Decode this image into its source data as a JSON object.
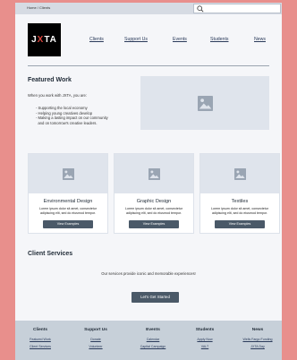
{
  "breadcrumb": "Home / Clients",
  "search": {
    "placeholder": ""
  },
  "logo": {
    "text_j": "J",
    "text_x": "X",
    "text_ta": "TA"
  },
  "nav": [
    "Clients",
    "Support Us",
    "Events",
    "Students",
    "News"
  ],
  "featured": {
    "title": "Featured Work",
    "intro": "When you work with JXTA, you are:",
    "bullets": [
      "- Supporting the local economy",
      "- Helping young creatives develop",
      "- Making a lasting impact on our community",
      "  and on tomorrow's creative leaders."
    ]
  },
  "cards": [
    {
      "title": "Environmental Design",
      "desc": "Lorem ipsum dolor sit amet, consectetur adipiscing elit, sed do eiusmod tempor.",
      "button": "View Examples"
    },
    {
      "title": "Graphic Design",
      "desc": "Lorem ipsum dolor sit amet, consectetur adipiscing elit, sed do eiusmod tempor.",
      "button": "View Examples"
    },
    {
      "title": "Textiles",
      "desc": "Lorem ipsum dolor sit amet, consectetur adipiscing elit, sed do eiusmod tempor.",
      "button": "View Examples"
    }
  ],
  "client_services": {
    "title": "Client Services",
    "text": "Our services provide iconic and memorable experiences!",
    "cta": "Let's Get Started"
  },
  "footer": [
    {
      "head": "Clients",
      "links": [
        "Featured Work",
        "Client Services"
      ]
    },
    {
      "head": "Support Us",
      "links": [
        "Donate",
        "Volunteer"
      ]
    },
    {
      "head": "Events",
      "links": [
        "Calendar",
        "Capital Campaign"
      ]
    },
    {
      "head": "Students",
      "links": [
        "Apply Now",
        "VALT"
      ]
    },
    {
      "head": "News",
      "links": [
        "Wells Fargo Funding",
        "JXTA Day"
      ]
    }
  ],
  "colors": {
    "background": "#e88f8c",
    "button": "#4a5968",
    "placeholder": "#dfe4ec",
    "logo_accent": "#d9423b"
  }
}
